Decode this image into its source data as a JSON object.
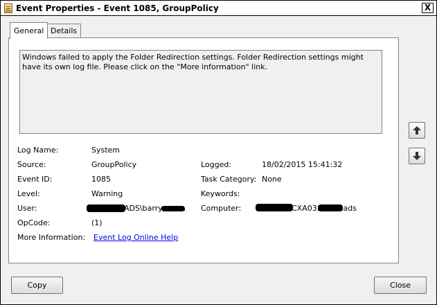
{
  "window": {
    "title": "Event Properties - Event 1085, GroupPolicy",
    "close_glyph": "X"
  },
  "tabs": [
    {
      "label": "General",
      "active": true
    },
    {
      "label": "Details",
      "active": false
    }
  ],
  "description": "Windows failed to apply the Folder Redirection settings. Folder Redirection settings might have its own log file. Please click on the \"More information\" link.",
  "fields": {
    "log_name": {
      "label": "Log Name:",
      "value": "System"
    },
    "source": {
      "label": "Source:",
      "value": "GroupPolicy"
    },
    "logged": {
      "label": "Logged:",
      "value": "18/02/2015 15:41:32"
    },
    "event_id": {
      "label": "Event ID:",
      "value": "1085"
    },
    "task_category": {
      "label": "Task Category:",
      "value": "None"
    },
    "level": {
      "label": "Level:",
      "value": "Warning"
    },
    "keywords": {
      "label": "Keywords:",
      "value": ""
    },
    "user": {
      "label": "User:",
      "value_a": "ADS\\barry",
      "value_b": "."
    },
    "computer": {
      "label": "Computer:",
      "value_a": "CXA03.",
      "value_b": ".ads"
    },
    "opcode": {
      "label": "OpCode:",
      "value": "(1)"
    },
    "more_info": {
      "label": "More Information:",
      "link": "Event Log Online Help"
    }
  },
  "buttons": {
    "copy": "Copy",
    "close": "Close"
  },
  "icons": {
    "previous": "arrow-up-icon",
    "next": "arrow-down-icon"
  }
}
